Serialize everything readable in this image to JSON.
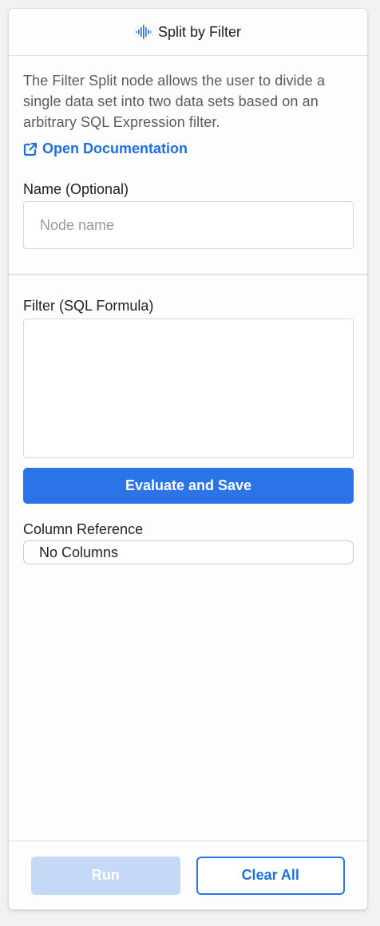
{
  "header": {
    "title": "Split by Filter",
    "icon": "split-waveform-icon",
    "icon_color": "#1f6fe0"
  },
  "intro": {
    "description": "The Filter Split node allows the user to divide a single data set into two data sets based on an arbitrary SQL Expression filter.",
    "doc_link_label": "Open Documentation",
    "doc_link_icon": "external-link-icon"
  },
  "name_field": {
    "label": "Name (Optional)",
    "placeholder": "Node name",
    "value": ""
  },
  "filter_field": {
    "label": "Filter (SQL Formula)",
    "value": ""
  },
  "evaluate_button": {
    "label": "Evaluate and Save"
  },
  "column_reference": {
    "label": "Column Reference",
    "value": "No Columns"
  },
  "footer": {
    "run_label": "Run",
    "clear_label": "Clear All"
  },
  "colors": {
    "accent": "#2a74e8",
    "link": "#1f6fe0",
    "run_disabled": "#c5d9f7"
  }
}
